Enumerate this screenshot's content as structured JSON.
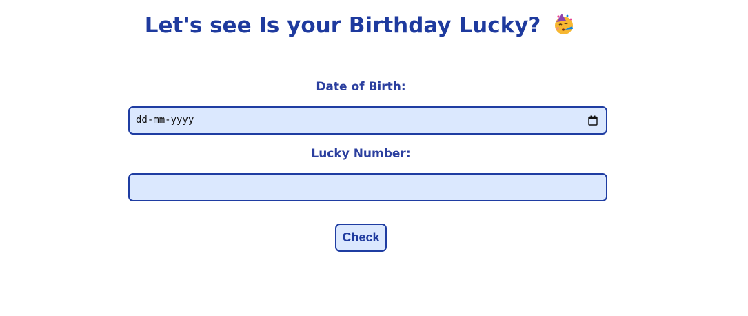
{
  "header": {
    "title": "Let's see Is your Birthday Lucky?",
    "emoji_icon": "partying-face-icon"
  },
  "form": {
    "dob_label": "Date of Birth:",
    "dob_placeholder": "dd-mm-yyyy",
    "dob_icon": "calendar-icon",
    "lucky_label": "Lucky Number:",
    "lucky_value": "",
    "check_label": "Check"
  },
  "colors": {
    "primary": "#1e3a9e",
    "field_background": "#dbe8fe",
    "field_border": "#1f3da2"
  }
}
